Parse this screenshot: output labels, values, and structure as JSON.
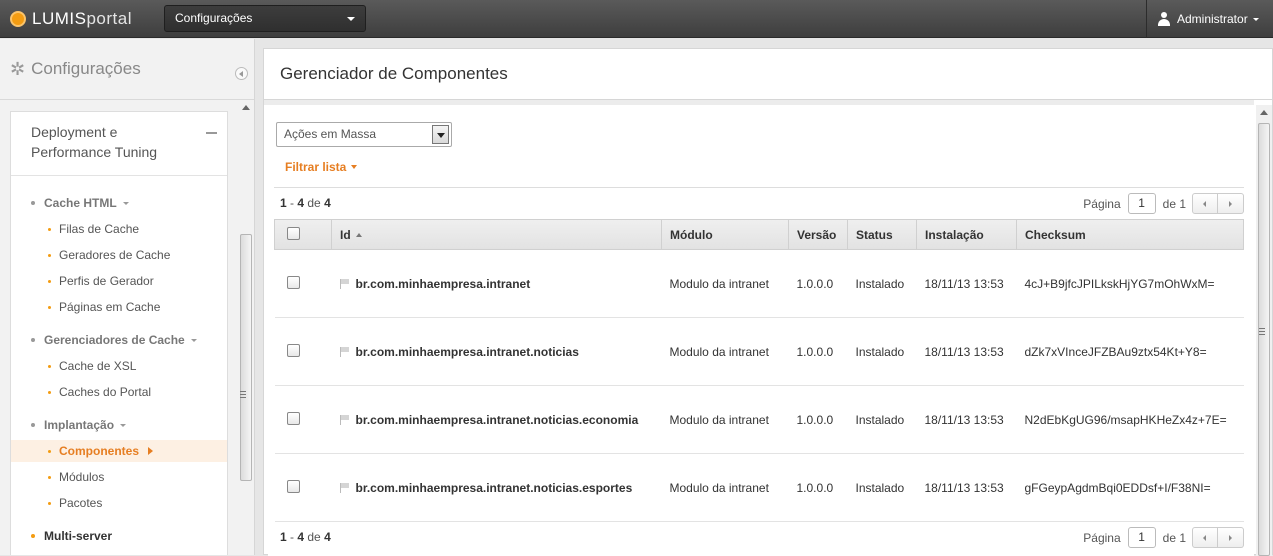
{
  "topbar": {
    "logo": {
      "lumis": "LUMIS",
      "portal": "portal"
    },
    "context_select": "Configurações",
    "user": "Administrator"
  },
  "sidebar": {
    "title": "Configurações",
    "panel_title": "Deployment e Performance Tuning",
    "sections": [
      {
        "label": "Cache HTML",
        "items": [
          "Filas de Cache",
          "Geradores de Cache",
          "Perfis de Gerador",
          "Páginas em Cache"
        ]
      },
      {
        "label": "Gerenciadores de Cache",
        "items": [
          "Cache de XSL",
          "Caches do Portal"
        ]
      },
      {
        "label": "Implantação",
        "items": [
          "Componentes",
          "Módulos",
          "Pacotes"
        ]
      },
      {
        "label": "Multi-server",
        "items": []
      }
    ],
    "active_item": "Componentes"
  },
  "main": {
    "title": "Gerenciador de Componentes",
    "bulk_actions": "Ações em Massa",
    "filter_label": "Filtrar lista",
    "count": {
      "from": "1",
      "dash": " - ",
      "to": "4",
      "of": " de ",
      "total": "4"
    },
    "pager": {
      "label": "Página",
      "page": "1",
      "of_total": "de 1"
    },
    "columns": [
      "Id",
      "Módulo",
      "Versão",
      "Status",
      "Instalação",
      "Checksum"
    ],
    "rows": [
      {
        "id": "br.com.minhaempresa.intranet",
        "modulo": "Modulo da intranet",
        "versao": "1.0.0.0",
        "status": "Instalado",
        "instalacao": "18/11/13 13:53",
        "checksum": "4cJ+B9jfcJPILkskHjYG7mOhWxM="
      },
      {
        "id": "br.com.minhaempresa.intranet.noticias",
        "modulo": "Modulo da intranet",
        "versao": "1.0.0.0",
        "status": "Instalado",
        "instalacao": "18/11/13 13:53",
        "checksum": "dZk7xVInceJFZBAu9ztx54Kt+Y8="
      },
      {
        "id": "br.com.minhaempresa.intranet.noticias.economia",
        "modulo": "Modulo da intranet",
        "versao": "1.0.0.0",
        "status": "Instalado",
        "instalacao": "18/11/13 13:53",
        "checksum": "N2dEbKgUG96/msapHKHeZx4z+7E="
      },
      {
        "id": "br.com.minhaempresa.intranet.noticias.esportes",
        "modulo": "Modulo da intranet",
        "versao": "1.0.0.0",
        "status": "Instalado",
        "instalacao": "18/11/13 13:53",
        "checksum": "gFGeypAgdmBqi0EDDsf+I/F38NI="
      }
    ]
  }
}
